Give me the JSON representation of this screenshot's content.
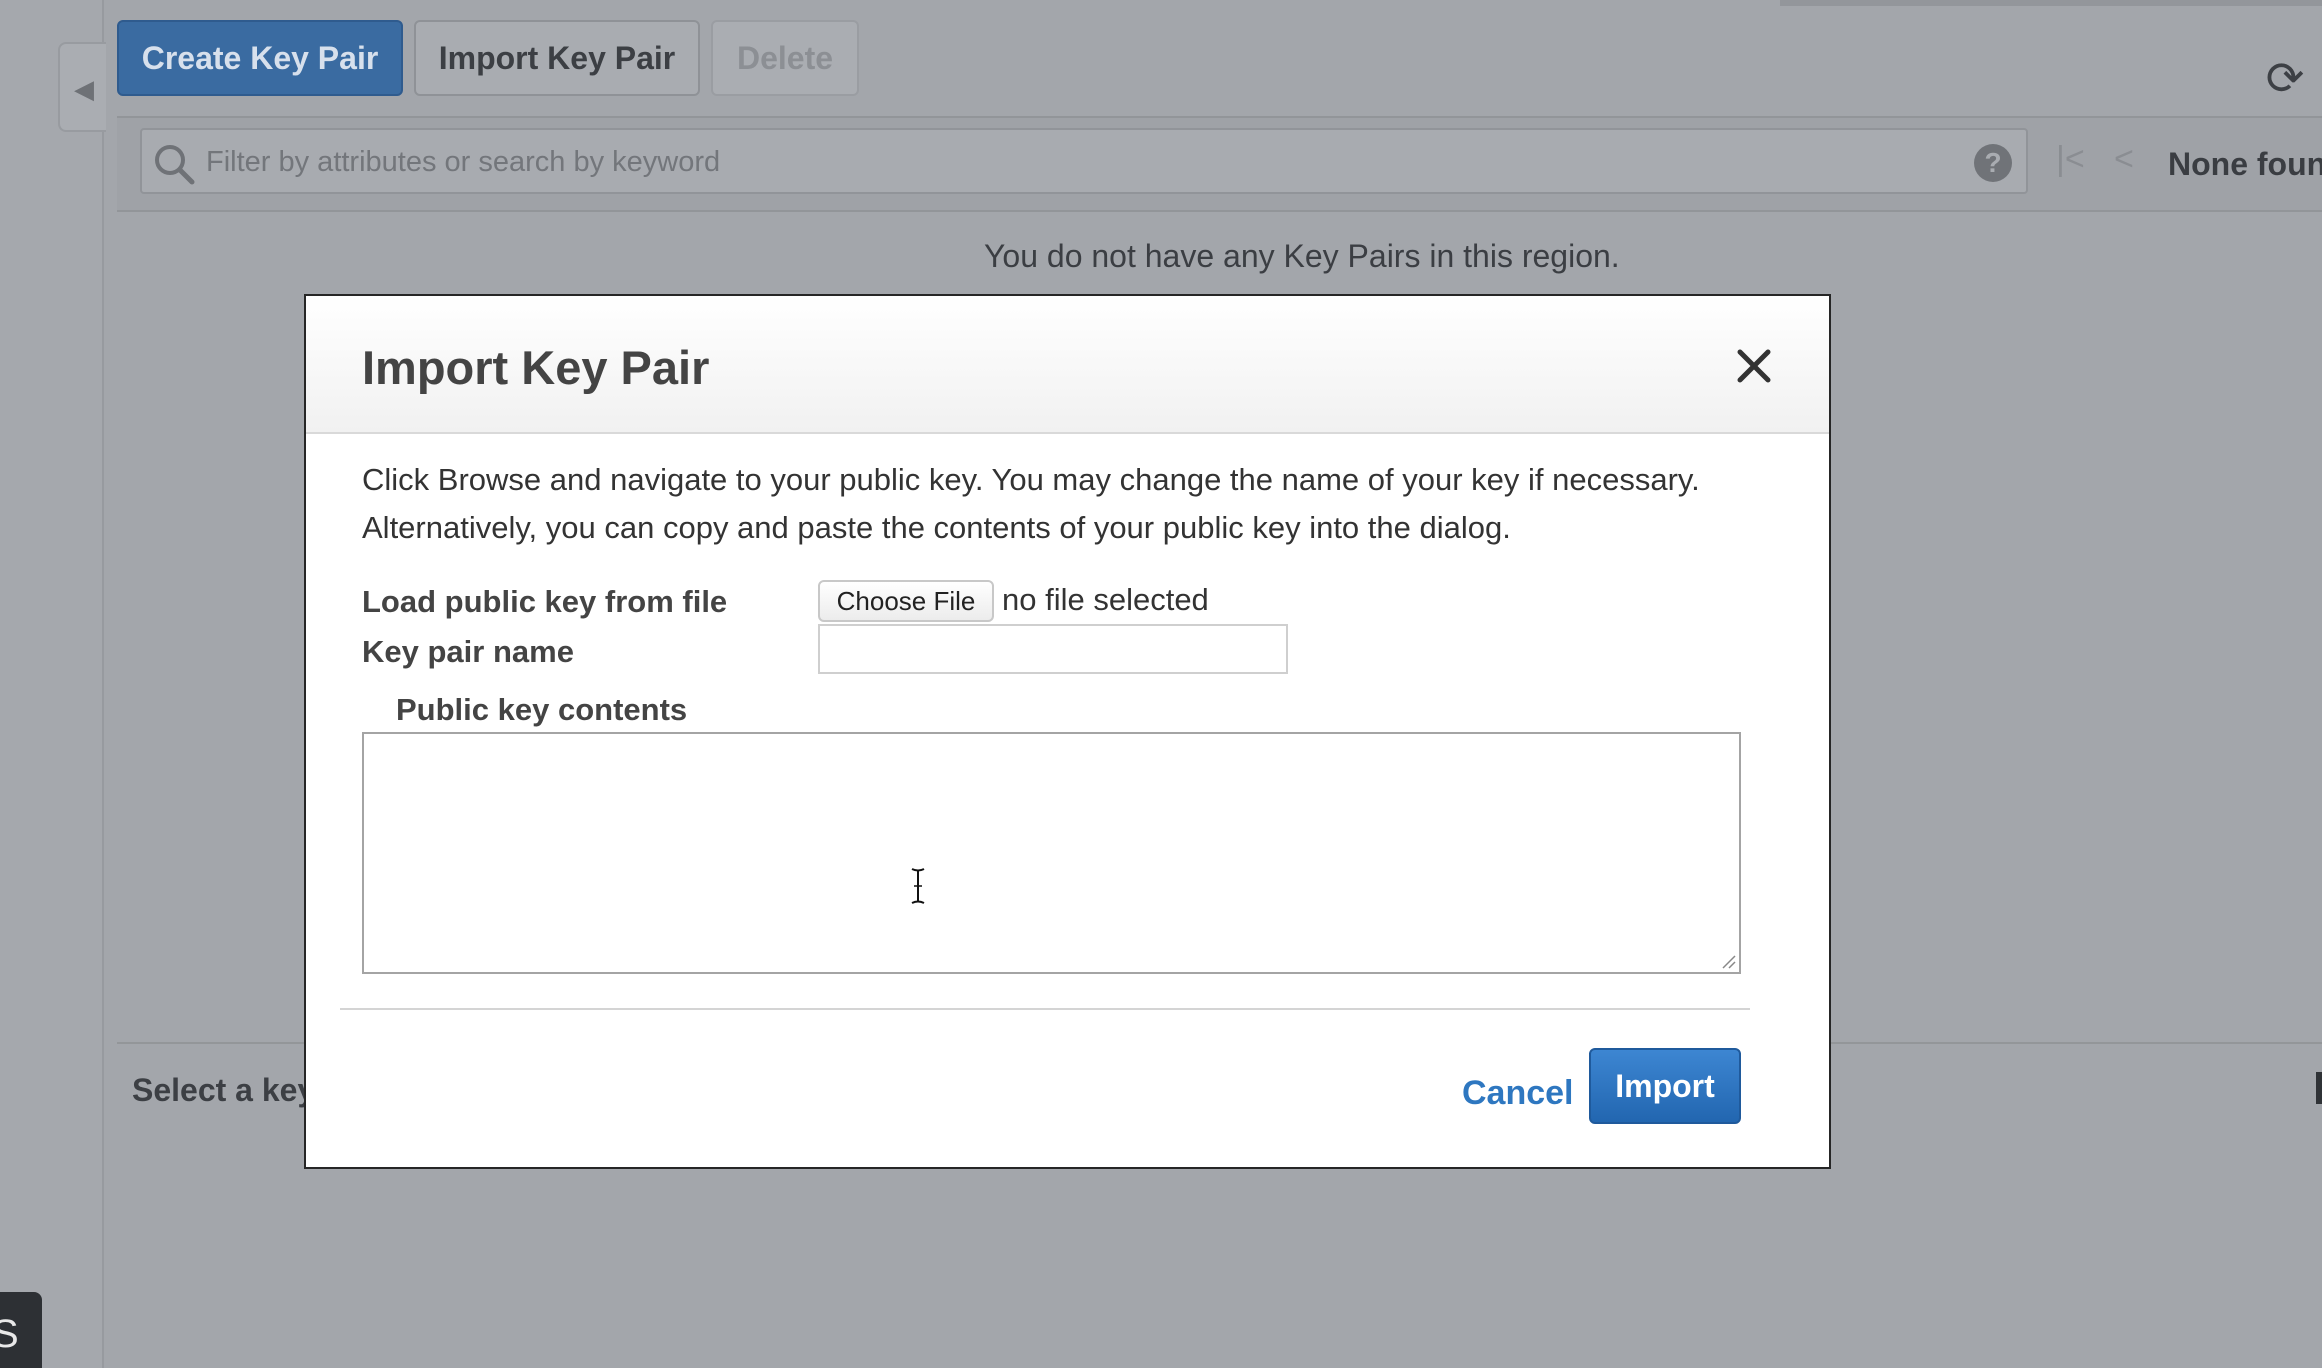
{
  "toolbar": {
    "create_label": "Create Key Pair",
    "import_label": "Import Key Pair",
    "delete_label": "Delete"
  },
  "filter": {
    "placeholder": "Filter by attributes or search by keyword",
    "help_glyph": "?",
    "pager_status": "None foun"
  },
  "main": {
    "empty_message": "You do not have any Key Pairs in this region.",
    "details_prompt": "Select a key"
  },
  "modal": {
    "title": "Import Key Pair",
    "description": "Click Browse and navigate to your public key. You may change the name of your key if necessary. Alternatively, you can copy and paste the contents of your public key into the dialog.",
    "load_label": "Load public key from file",
    "choose_file_label": "Choose File",
    "no_file_text": "no file selected",
    "name_label": "Key pair name",
    "name_value": "",
    "contents_label": "Public key contents",
    "contents_value": "",
    "cancel_label": "Cancel",
    "import_label": "Import"
  },
  "icons": {
    "close": "close-icon",
    "search": "search-icon",
    "refresh": "refresh-icon",
    "help": "help-icon"
  },
  "colors": {
    "primary": "#2266b0",
    "link": "#2e77c0",
    "overlay": "#a3a6ab"
  }
}
